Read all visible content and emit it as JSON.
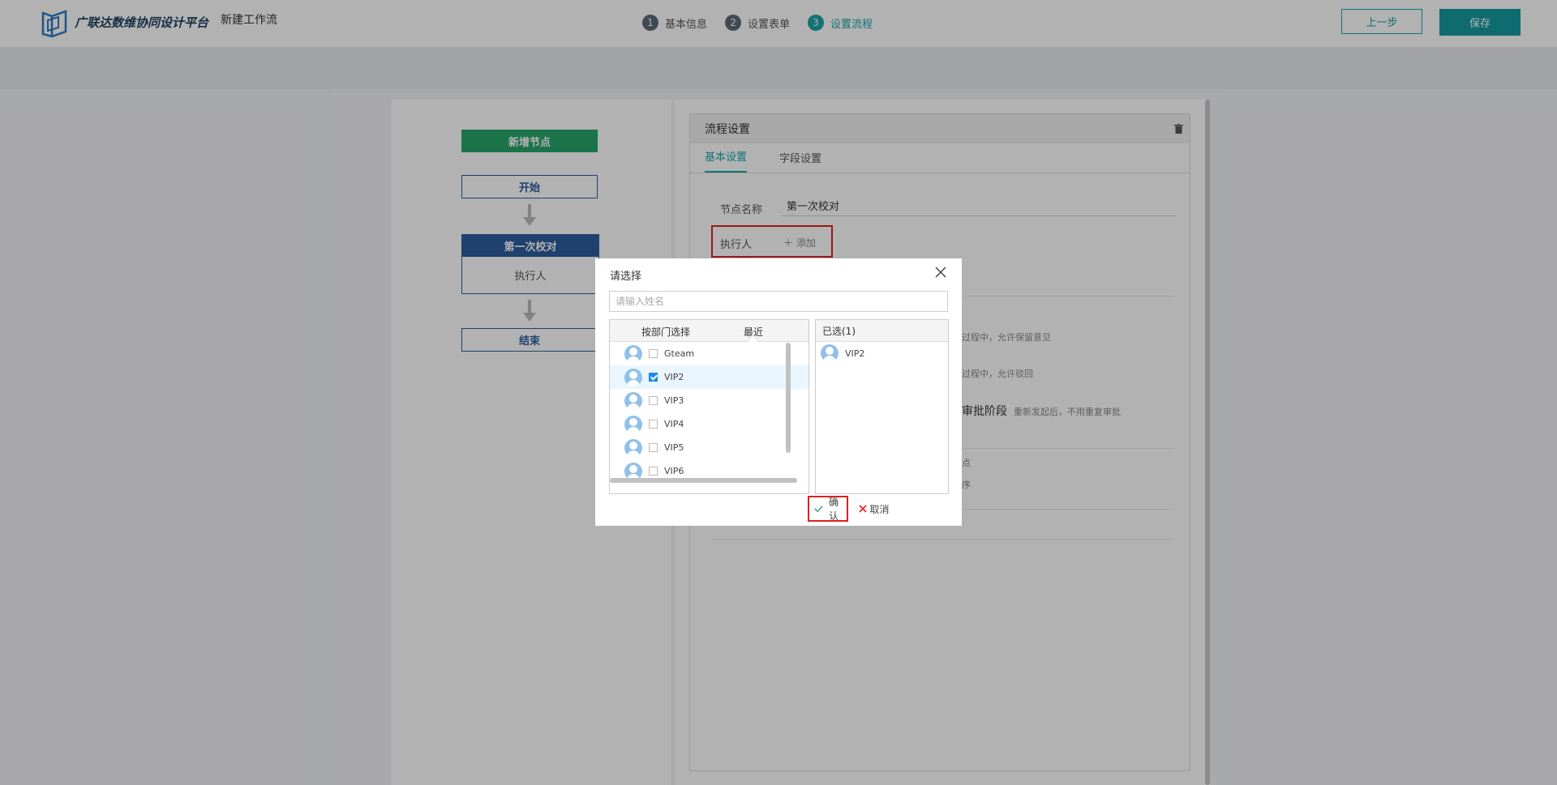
{
  "header": {
    "brand": "广联达数维协同设计平台",
    "page_name": "新建工作流",
    "steps": [
      {
        "num": "1",
        "label": "基本信息",
        "active": false
      },
      {
        "num": "2",
        "label": "设置表单",
        "active": false
      },
      {
        "num": "3",
        "label": "设置流程",
        "active": true
      }
    ],
    "prev_label": "上一步",
    "save_label": "保存"
  },
  "flow": {
    "add_node_label": "新增节点",
    "start_label": "开始",
    "current_node_title": "第一次校对",
    "current_node_sub": "执行人",
    "end_label": "结束"
  },
  "settings": {
    "title": "流程设置",
    "tabs": [
      "基本设置",
      "字段设置"
    ],
    "node_name_label": "节点名称",
    "node_name_value": "第一次校对",
    "executor_label": "执行人",
    "add_label": "添加",
    "option_1": "过程中，允许保留意见",
    "option_2": "过程中，允许驳回",
    "option_3_big": "审批阶段",
    "option_3_small": "重新发起后，不用重复审批",
    "option_4": "点",
    "option_5": "序"
  },
  "dialog": {
    "title": "请选择",
    "search_placeholder": "请输入姓名",
    "tab_dept": "按部门选择",
    "tab_recent": "最近",
    "users": [
      {
        "name": "Gteam",
        "checked": false
      },
      {
        "name": "VIP2",
        "checked": true
      },
      {
        "name": "VIP3",
        "checked": false
      },
      {
        "name": "VIP4",
        "checked": false
      },
      {
        "name": "VIP5",
        "checked": false
      },
      {
        "name": "VIP6",
        "checked": false
      }
    ],
    "selected_header": "已选(1)",
    "selected": [
      "VIP2"
    ],
    "ok_label": "确认",
    "cancel_label": "取消"
  },
  "colors": {
    "accent": "#1aa5a8",
    "node_blue": "#2b5d9e",
    "add_green": "#27a56a",
    "highlight_red": "#e02020",
    "check_blue": "#1e88e5"
  }
}
